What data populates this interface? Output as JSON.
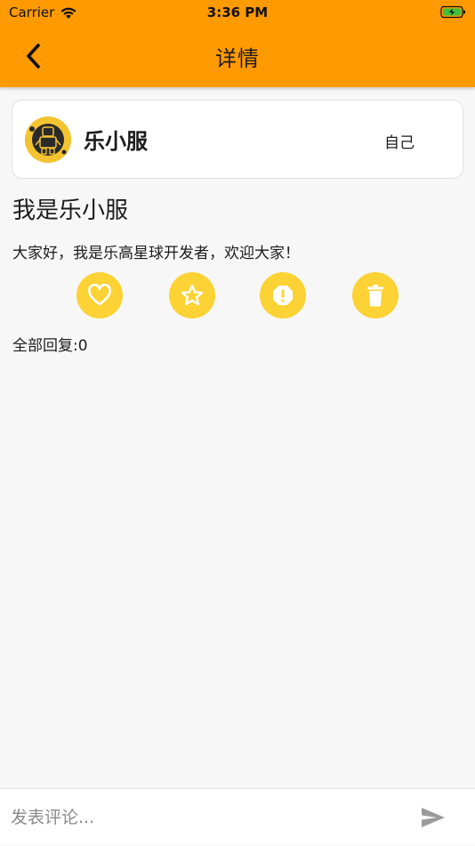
{
  "status_bar": {
    "carrier": "Carrier",
    "time": "3:36 PM",
    "wifi_icon": "wifi-icon",
    "battery_icon": "battery-charging-icon"
  },
  "nav": {
    "title": "详情",
    "back_icon": "chevron-left-icon"
  },
  "author": {
    "name": "乐小服",
    "tag": "自己",
    "avatar_icon": "robot-avatar-icon"
  },
  "post": {
    "title": "我是乐小服",
    "body": "大家好，我是乐高星球开发者，欢迎大家！"
  },
  "actions": [
    {
      "icon": "heart-icon"
    },
    {
      "icon": "star-icon"
    },
    {
      "icon": "report-icon"
    },
    {
      "icon": "trash-icon"
    }
  ],
  "replies": {
    "label": "全部回复:0"
  },
  "comment": {
    "placeholder": "发表评论...",
    "value": "",
    "send_icon": "send-icon"
  },
  "colors": {
    "header": "#ff9a00",
    "action_button": "#fcd234",
    "background": "#f7f7f7"
  }
}
